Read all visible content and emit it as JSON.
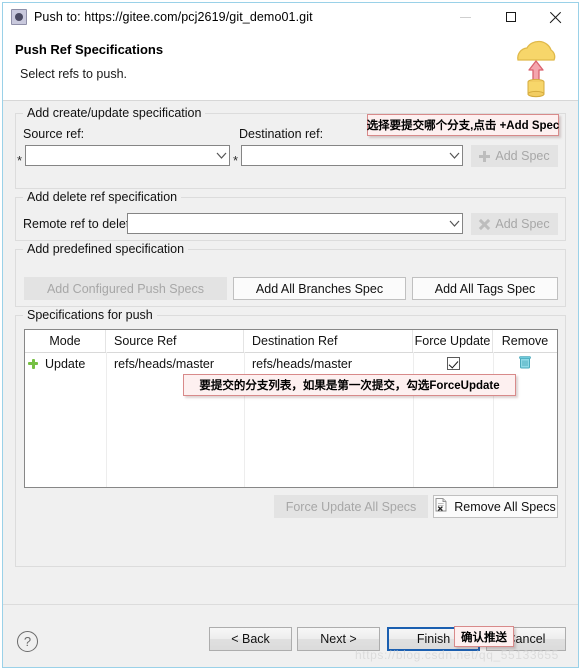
{
  "window": {
    "title": "Push to: https://gitee.com/pcj2619/git_demo01.git",
    "icon": "push-repository-icon",
    "minimize_label": "–",
    "maximize_label": "□",
    "close_label": "✕"
  },
  "header": {
    "title": "Push Ref Specifications",
    "subtitle": "Select refs to push.",
    "art_icon": "cloud-upload-icon"
  },
  "create_update_group": {
    "legend": "Add create/update specification",
    "source_ref_label": "Source ref:",
    "source_ref_value": "",
    "source_ref_required_marker": "*",
    "destination_ref_label": "Destination ref:",
    "destination_ref_value": "",
    "destination_ref_required_marker": "*",
    "add_spec_label": "Add Spec",
    "add_spec_icon": "plus-icon",
    "add_spec_enabled": false
  },
  "delete_group": {
    "legend": "Add delete ref specification",
    "remote_ref_label": "Remote ref to delete:",
    "remote_ref_value": "",
    "add_spec_label": "Add Spec",
    "add_spec_icon": "cross-icon",
    "add_spec_enabled": false
  },
  "predefined_group": {
    "legend": "Add predefined specification",
    "buttons": [
      {
        "label": "Add Configured Push Specs",
        "enabled": false
      },
      {
        "label": "Add All Branches Spec",
        "enabled": true
      },
      {
        "label": "Add All Tags Spec",
        "enabled": true
      }
    ]
  },
  "specs_group": {
    "legend": "Specifications for push",
    "columns": [
      "Mode",
      "Source Ref",
      "Destination Ref",
      "Force Update",
      "Remove"
    ],
    "rows": [
      {
        "status_icon": "green-plus-icon",
        "mode": "Update",
        "source_ref": "refs/heads/master",
        "destination_ref": "refs/heads/master",
        "force_update": true,
        "remove_icon": "trash-icon"
      }
    ],
    "force_update_all_label": "Force Update All Specs",
    "force_update_all_enabled": false,
    "remove_all_label": "Remove All Specs",
    "remove_all_icon": "remove-document-icon",
    "remove_all_enabled": true
  },
  "footer": {
    "help_label": "?",
    "back_label": "< Back",
    "next_label": "Next >",
    "finish_label": "Finish",
    "cancel_label": "Cancel"
  },
  "annotations": [
    {
      "text": "选择要提交哪个分支,点击 +Add Spec"
    },
    {
      "text": "要提交的分支列表，如果是第一次提交，勾选ForceUpdate"
    },
    {
      "text": "确认推送"
    }
  ],
  "watermark": "https://blog.csdn.net/qq_55133655",
  "colors": {
    "window_border": "#9ad1e8",
    "annotation_border": "#d88a8a",
    "annotation_bg": "#fdf0f0",
    "green_plus": "#76c043",
    "trash": "#5ec8d8",
    "cloud": "#f5d469",
    "arrow": "#e8707a",
    "default_button_border": "#1b5fb0"
  }
}
